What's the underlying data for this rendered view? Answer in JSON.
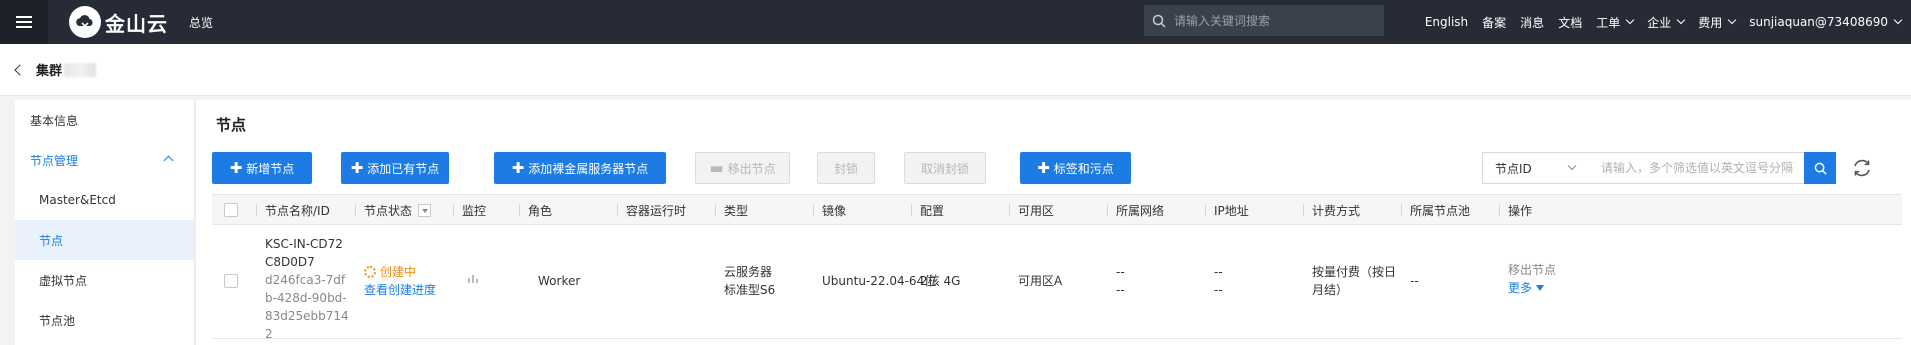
{
  "topbar": {
    "logo_text": "金山云",
    "overview": "总览",
    "search_placeholder": "请输入关键词搜索",
    "links": [
      "English",
      "备案",
      "消息",
      "文档"
    ],
    "dropdowns": [
      "工单",
      "企业",
      "费用",
      "sunjiaquan@73408690"
    ]
  },
  "breadcrumb": {
    "title": "集群"
  },
  "sidebar": {
    "items": [
      {
        "label": "基本信息"
      },
      {
        "label": "节点管理"
      },
      {
        "label": "Master&Etcd"
      },
      {
        "label": "节点"
      },
      {
        "label": "虚拟节点"
      },
      {
        "label": "节点池"
      }
    ]
  },
  "main": {
    "title": "节点",
    "buttons": {
      "add_node": "新增节点",
      "add_existing": "添加已有节点",
      "add_bare_metal": "添加裸金属服务器节点",
      "remove_node": "移出节点",
      "cordon": "封锁",
      "uncordon": "取消封锁",
      "labels_taints": "标签和污点"
    },
    "filter": {
      "select_value": "节点ID",
      "input_placeholder": "请输入，多个筛选值以英文逗号分隔"
    }
  },
  "table": {
    "headers": [
      "节点名称/ID",
      "节点状态",
      "监控",
      "角色",
      "容器运行时",
      "类型",
      "镜像",
      "配置",
      "可用区",
      "所属网络",
      "IP地址",
      "计费方式",
      "所属节点池",
      "操作"
    ],
    "rows": [
      {
        "name": "KSC-IN-CD72C8D0D7",
        "id": "d246fca3-7dfb-428d-90bd-83d25ebb7142",
        "status": "创建中",
        "status_link": "查看创建进度",
        "role": "Worker",
        "runtime": "",
        "type_line1": "云服务器",
        "type_line2": "标准型S6",
        "image": "Ubuntu-22.04-64位",
        "config": "2核 4G",
        "zone": "可用区A",
        "network_line1": "--",
        "network_line2": "--",
        "ip_line1": "--",
        "ip_line2": "--",
        "billing": "按量付费（按日月结）",
        "node_pool": "--",
        "action_remove": "移出节点",
        "action_more": "更多"
      }
    ]
  },
  "colors": {
    "primary": "#1c7ce4",
    "topbar": "#262b35",
    "creating": "#f08a1c"
  }
}
